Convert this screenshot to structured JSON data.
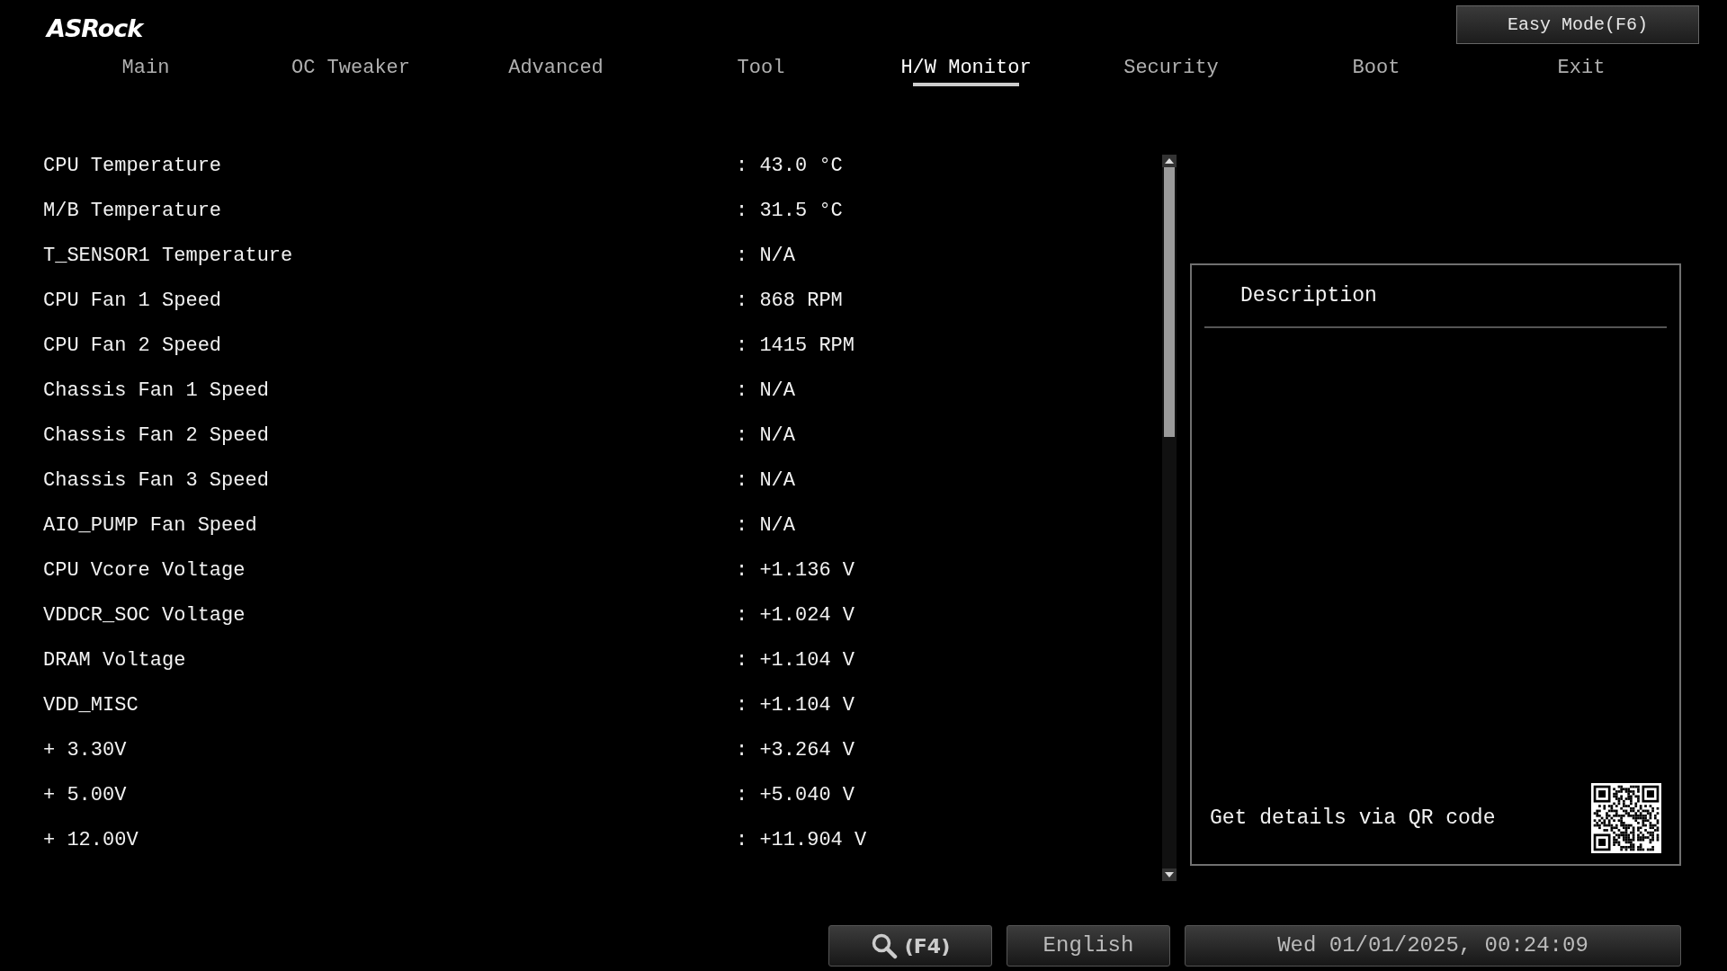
{
  "logo": "ASRock",
  "easy_mode_button": "Easy Mode(F6)",
  "tabs": [
    {
      "label": "Main",
      "selected": false
    },
    {
      "label": "OC Tweaker",
      "selected": false
    },
    {
      "label": "Advanced",
      "selected": false
    },
    {
      "label": "Tool",
      "selected": false
    },
    {
      "label": "H/W Monitor",
      "selected": true
    },
    {
      "label": "Security",
      "selected": false
    },
    {
      "label": "Boot",
      "selected": false
    },
    {
      "label": "Exit",
      "selected": false
    }
  ],
  "rows": [
    {
      "label": "CPU Temperature",
      "value": ": 43.0 °C"
    },
    {
      "label": "M/B Temperature",
      "value": ": 31.5 °C"
    },
    {
      "label": "T_SENSOR1 Temperature",
      "value": ": N/A"
    },
    {
      "label": "CPU Fan 1 Speed",
      "value": ": 868 RPM"
    },
    {
      "label": "CPU Fan 2 Speed",
      "value": ": 1415 RPM"
    },
    {
      "label": "Chassis Fan 1 Speed",
      "value": ": N/A"
    },
    {
      "label": "Chassis Fan 2 Speed",
      "value": ": N/A"
    },
    {
      "label": "Chassis Fan 3 Speed",
      "value": ": N/A"
    },
    {
      "label": "AIO_PUMP Fan Speed",
      "value": ": N/A"
    },
    {
      "label": "CPU Vcore Voltage",
      "value": ": +1.136 V"
    },
    {
      "label": "VDDCR_SOC Voltage",
      "value": ": +1.024 V"
    },
    {
      "label": "DRAM Voltage",
      "value": ": +1.104 V"
    },
    {
      "label": "VDD_MISC",
      "value": ": +1.104 V"
    },
    {
      "label": "+ 3.30V",
      "value": ": +3.264 V"
    },
    {
      "label": "+ 5.00V",
      "value": ": +5.040 V"
    },
    {
      "label": "+ 12.00V",
      "value": ": +11.904 V"
    }
  ],
  "description": {
    "title": "Description",
    "qr_text": "Get details via QR code"
  },
  "bottom_bar": {
    "search_key": "(F4)",
    "language": "English",
    "datetime": "Wed 01/01/2025, 00:24:09"
  }
}
